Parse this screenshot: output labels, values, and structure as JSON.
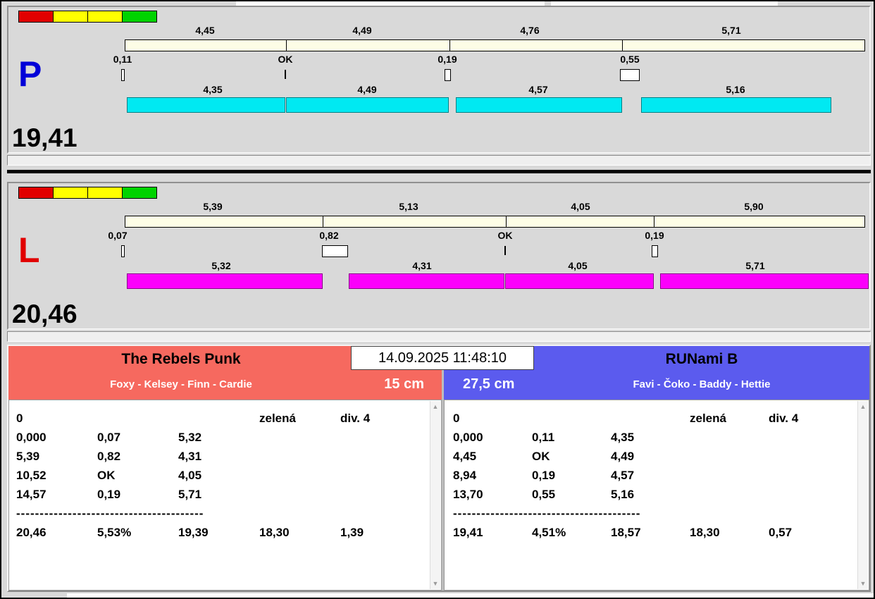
{
  "clock": "14.09.2025 11:48:10",
  "icons": {
    "scroll_up": "▲",
    "scroll_down": "▼"
  },
  "lights": {
    "colors": [
      "#e10000",
      "#ffff00",
      "#ffff00",
      "#00d300"
    ]
  },
  "panels": [
    {
      "lane": "P",
      "lane_color": "#0000d8",
      "total": "19,41",
      "splits_top": [
        "4,45",
        "4,49",
        "4,76",
        "5,71"
      ],
      "marks": [
        "0,11",
        "OK",
        "0,19",
        "0,55"
      ],
      "splits_bottom": [
        "4,35",
        "4,49",
        "4,57",
        "5,16"
      ],
      "bar_color": "#00e9f2"
    },
    {
      "lane": "L",
      "lane_color": "#e10000",
      "total": "20,46",
      "splits_top": [
        "5,39",
        "5,13",
        "4,05",
        "5,90"
      ],
      "marks": [
        "0,07",
        "0,82",
        "OK",
        "0,19"
      ],
      "splits_bottom": [
        "5,32",
        "4,31",
        "4,05",
        "5,71"
      ],
      "bar_color": "#fb00fb"
    }
  ],
  "teams": [
    {
      "name": "The Rebels Punk",
      "dogs": "Foxy - Kelsey - Finn - Cardie",
      "jump_height": "15 cm",
      "header_color": "#f6695f",
      "info": [
        "0",
        "zelená",
        "div. 4"
      ],
      "runs": [
        [
          "0,000",
          "0,07",
          "5,32"
        ],
        [
          "5,39",
          "0,82",
          "4,31"
        ],
        [
          "10,52",
          "OK",
          "4,05"
        ],
        [
          "14,57",
          "0,19",
          "5,71"
        ]
      ],
      "separator": "----------------------------------------",
      "totals": [
        "20,46",
        "5,53%",
        "19,39",
        "18,30",
        "1,39"
      ]
    },
    {
      "name": "RUNami B",
      "dogs": "Favi - Čoko - Baddy - Hettie",
      "jump_height": "27,5 cm",
      "header_color": "#5b5bee",
      "info": [
        "0",
        "zelená",
        "div. 4"
      ],
      "runs": [
        [
          "0,000",
          "0,11",
          "4,35"
        ],
        [
          "4,45",
          "OK",
          "4,49"
        ],
        [
          "8,94",
          "0,19",
          "4,57"
        ],
        [
          "13,70",
          "0,55",
          "5,16"
        ]
      ],
      "separator": "----------------------------------------",
      "totals": [
        "19,41",
        "4,51%",
        "18,57",
        "18,30",
        "0,57"
      ]
    }
  ]
}
